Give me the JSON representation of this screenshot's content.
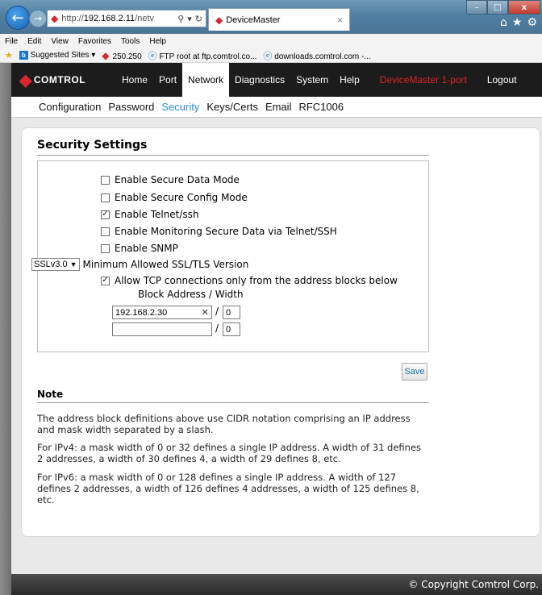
{
  "browser": {
    "address_prefix": "http://",
    "address_host": "192.168.2.11",
    "address_rest": "/netv",
    "tab_title": "DeviceMaster",
    "tab_close": "×",
    "window_buttons": {
      "minimize": "–",
      "maximize": "□",
      "close": "x"
    }
  },
  "menubar": [
    "File",
    "Edit",
    "View",
    "Favorites",
    "Tools",
    "Help"
  ],
  "favorites": {
    "suggested": "Suggested Sites ▾",
    "item1": "250.250",
    "item2": "FTP root at ftp.comtrol.co...",
    "item3": "downloads.comtrol.com -..."
  },
  "topnav": {
    "logo": "COMTROL",
    "items": [
      "Home",
      "Port",
      "Network",
      "Diagnostics",
      "System",
      "Help"
    ],
    "active": "Network",
    "device": "DeviceMaster 1-port",
    "logout": "Logout"
  },
  "subnav": {
    "items": [
      "Configuration",
      "Password",
      "Security",
      "Keys/Certs",
      "Email",
      "RFC1006"
    ],
    "active": "Security"
  },
  "security": {
    "title": "Security Settings",
    "options": [
      {
        "label": "Enable Secure Data Mode",
        "checked": false
      },
      {
        "label": "Enable Secure Config Mode",
        "checked": false
      },
      {
        "label": "Enable Telnet/ssh",
        "checked": true
      },
      {
        "label": "Enable Monitoring Secure Data via Telnet/SSH",
        "checked": false
      },
      {
        "label": "Enable SNMP",
        "checked": false
      }
    ],
    "tls_select_value": "SSLv3.0",
    "tls_label": "Minimum Allowed SSL/TLS Version",
    "allow_tcp_label": "Allow TCP connections only from the address blocks below",
    "allow_tcp_checked": true,
    "block_header": "Block Address / Width",
    "blocks": [
      {
        "address": "192.168.2.30",
        "width": "0"
      },
      {
        "address": "",
        "width": "0"
      }
    ],
    "save_label": "Save"
  },
  "note": {
    "title": "Note",
    "p1": "The address block definitions above use CIDR notation comprising an IP address and mask width separated by a slash.",
    "p2": "For IPv4: a mask width of 0 or 32 defines a single IP address. A width of 31 defines 2 addresses, a width of 30 defines 4, a width of 29 defines 8, etc.",
    "p3": "For IPv6: a mask width of 0 or 128 defines a single IP address. A width of 127 defines 2 addresses, a width of 126 defines 4 addresses, a width of 125 defines 8, etc."
  },
  "footer": {
    "copyright": "© Copyright Comtrol Corp."
  },
  "colors": {
    "brand_red": "#d8262e",
    "active_link": "#2a8de0",
    "nav_bg": "#1c1c1c"
  }
}
